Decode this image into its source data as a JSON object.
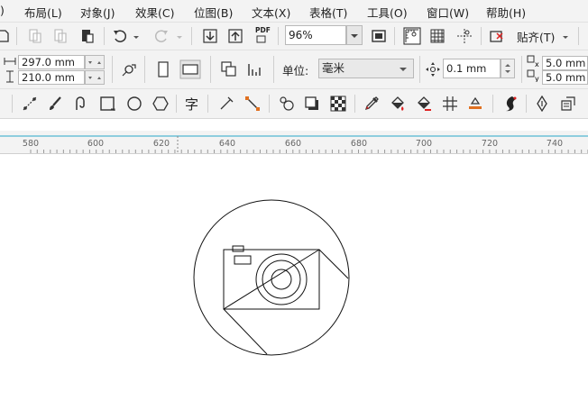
{
  "menu": {
    "items": [
      "布局(L)",
      "对象(J)",
      "效果(C)",
      "位图(B)",
      "文本(X)",
      "表格(T)",
      "工具(O)",
      "窗口(W)",
      "帮助(H)"
    ],
    "partial_left": ")"
  },
  "toolbar": {
    "zoom_value": "96%",
    "pdf_label": "PDF",
    "snap_label": "贴齐(T)"
  },
  "property_bar": {
    "page_width": "297.0 mm",
    "page_height": "210.0 mm",
    "units_label": "单位:",
    "units_value": "毫米",
    "nudge_value": "0.1 mm",
    "duplicate_x": "5.0 mm",
    "duplicate_y": "5.0 mm"
  },
  "toolbox": {
    "text_tool_label": "字"
  },
  "ruler": {
    "ticks": [
      "580",
      "600",
      "620",
      "640",
      "660",
      "680",
      "700",
      "720",
      "740"
    ],
    "accent_color": "#2aa7c8"
  },
  "icons": [
    "undo-icon",
    "redo-icon",
    "import-icon",
    "export-icon",
    "pdf-icon",
    "fullscreen-icon",
    "grid-icon",
    "snap-icon",
    "page-portrait-icon",
    "page-landscape-icon",
    "freehand-icon",
    "brush-icon",
    "rectangle-icon",
    "ellipse-icon",
    "polygon-icon",
    "text-icon",
    "connector-icon",
    "transparency-icon",
    "eyedropper-icon",
    "fill-icon",
    "pen-icon"
  ]
}
